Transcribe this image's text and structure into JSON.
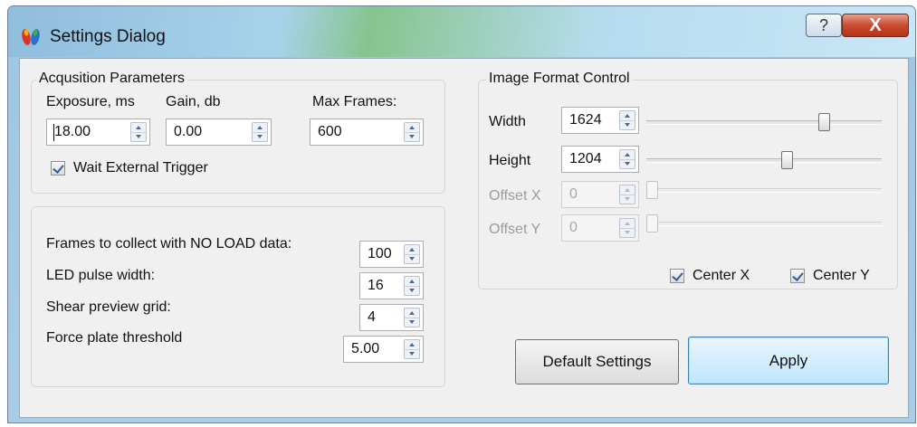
{
  "window": {
    "title": "Settings Dialog",
    "help_label": "?",
    "close_label": "X"
  },
  "acquisition": {
    "group_title": "Acqusition Parameters",
    "exposure_label": "Exposure, ms",
    "exposure_value": "18.00",
    "gain_label": "Gain, db",
    "gain_value": "0.00",
    "max_frames_label": "Max Frames:",
    "max_frames_value": "600",
    "wait_trigger_label": "Wait External Trigger",
    "wait_trigger_checked": true
  },
  "processing": {
    "rows": [
      {
        "label": "Frames to collect with NO LOAD data:",
        "value": "100"
      },
      {
        "label": "LED pulse width:",
        "value": "16"
      },
      {
        "label": "Shear preview grid:",
        "value": "4"
      },
      {
        "label": "Force plate threshold",
        "value": "5.00"
      }
    ]
  },
  "image_format": {
    "group_title": "Image Format Control",
    "rows": [
      {
        "label": "Width",
        "value": "1624",
        "enabled": true,
        "slider_level": 0.78
      },
      {
        "label": "Height",
        "value": "1204",
        "enabled": true,
        "slider_level": 0.58
      },
      {
        "label": "Offset X",
        "value": "0",
        "enabled": false,
        "slider_level": 0.0
      },
      {
        "label": "Offset Y",
        "value": "0",
        "enabled": false,
        "slider_level": 0.0
      }
    ],
    "center_x_label": "Center X",
    "center_x_checked": true,
    "center_y_label": "Center Y",
    "center_y_checked": true
  },
  "buttons": {
    "default_settings": "Default Settings",
    "apply": "Apply"
  }
}
